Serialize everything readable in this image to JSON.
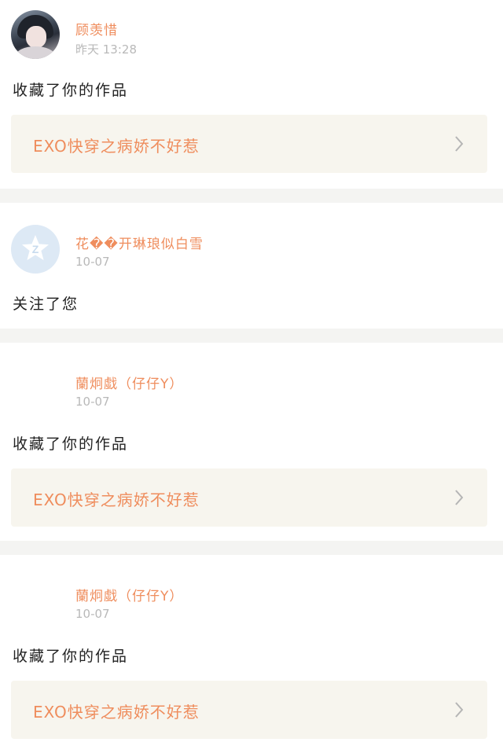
{
  "notifications": [
    {
      "user": "顾羡惜",
      "time": "昨天 13:28",
      "action": "收藏了你的作品",
      "work_title": "EXO快穿之病娇不好惹"
    },
    {
      "user": "花��开琳琅似白雪",
      "time": "10-07",
      "action": "关注了您"
    },
    {
      "user": "蘭炯戱（仔仔Y）",
      "time": "10-07",
      "action": "收藏了你的作品",
      "work_title": "EXO快穿之病娇不好惹"
    },
    {
      "user": "蘭炯戱（仔仔Y）",
      "time": "10-07",
      "action": "收藏了你的作品",
      "work_title": "EXO快穿之病娇不好惹"
    }
  ],
  "colors": {
    "accent": "#ef8d5d",
    "card_background": "#f7f5ee",
    "separator": "#f4f4f2",
    "timestamp": "#b9b9b9"
  },
  "icons": [
    "chevron-right-icon",
    "default-avatar-star-icon"
  ]
}
